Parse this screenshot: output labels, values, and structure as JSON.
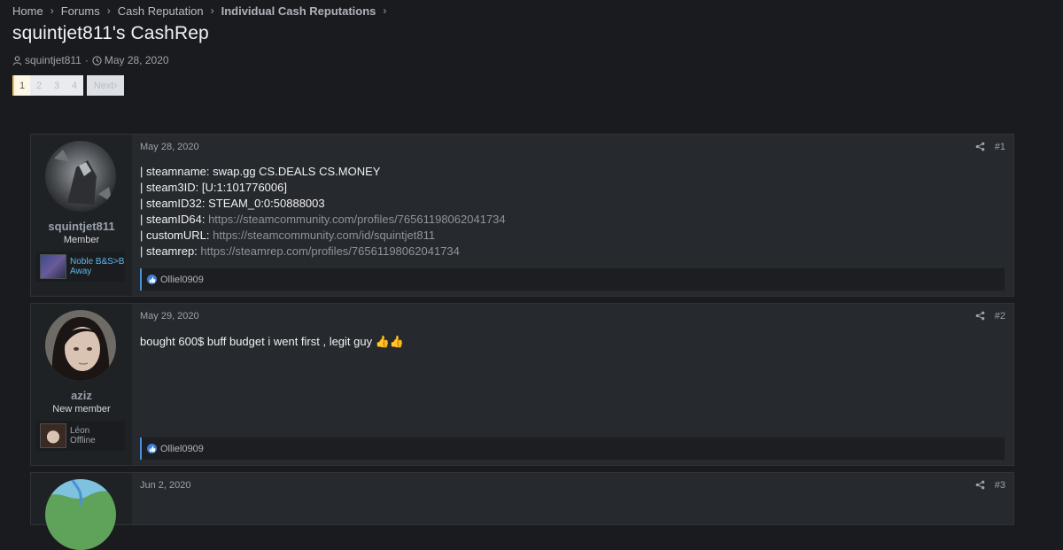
{
  "breadcrumb": {
    "items": [
      "Home",
      "Forums",
      "Cash Reputation",
      "Individual Cash Reputations"
    ]
  },
  "thread": {
    "title": "squintjet811's CashRep",
    "author": "squintjet811",
    "date": "May 28, 2020"
  },
  "pagination": {
    "pages": [
      "1",
      "2",
      "3",
      "4"
    ],
    "current": "1",
    "next_label": "Next"
  },
  "posts": [
    {
      "username": "squintjet811",
      "role": "Member",
      "banner_line1": "Noble B&S>B",
      "banner_line2": "Away",
      "banner_color": "#5bb8e8",
      "date": "May 28, 2020",
      "number": "#1",
      "lines": [
        {
          "label": "| steamname: ",
          "value": "swap.gg CS.DEALS CS.MONEY"
        },
        {
          "label": "| steam3ID: ",
          "value": "[U:1:101776006]"
        },
        {
          "label": "| steamID32: ",
          "value": "STEAM_0:0:50888003"
        },
        {
          "label": "| steamID64: ",
          "link": "https://steamcommunity.com/profiles/76561198062041734"
        },
        {
          "label": "| customURL: ",
          "link": "https://steamcommunity.com/id/squintjet811"
        },
        {
          "label": "| steamrep: ",
          "link": "https://steamrep.com/profiles/76561198062041734"
        }
      ],
      "reaction_user": "Olliel0909"
    },
    {
      "username": "aziz",
      "role": "New member",
      "banner_line1": "Léon",
      "banner_line2": "Offline",
      "banner_color": "#9ea2a9",
      "date": "May 29, 2020",
      "number": "#2",
      "text": "bought 600$ buff budget i went first , legit guy 👍👍",
      "reaction_user": "Olliel0909"
    },
    {
      "date": "Jun 2, 2020",
      "number": "#3"
    }
  ],
  "icons": {
    "user": "user-icon",
    "clock": "clock-icon",
    "share": "share-icon",
    "like": "like-icon",
    "chevron": "chevron-right-icon"
  }
}
